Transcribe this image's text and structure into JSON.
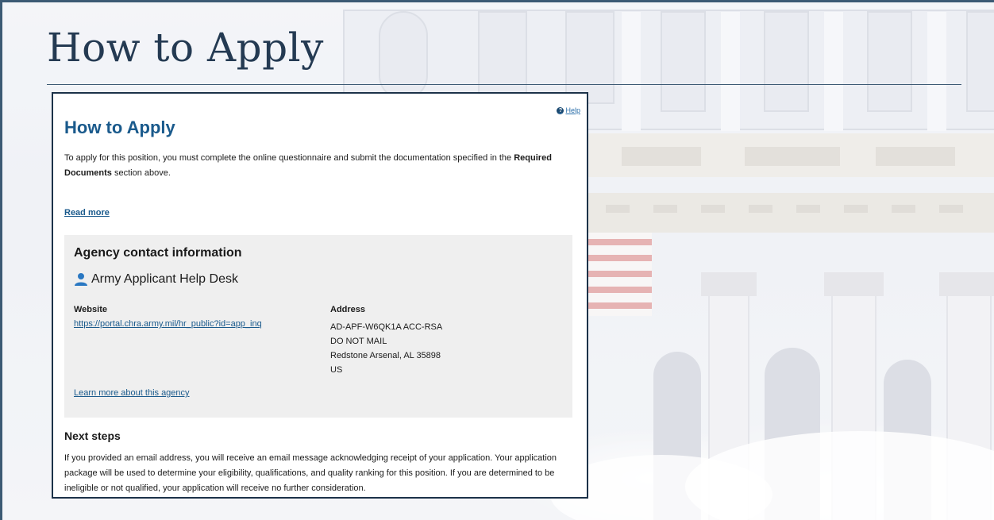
{
  "page": {
    "title": "How to Apply"
  },
  "card": {
    "help_label": "Help",
    "heading": "How to Apply",
    "intro_before": "To apply for this position, you must complete the online questionnaire and submit the documentation specified in the",
    "intro_bold": "Required Documents",
    "intro_after": "section above.",
    "read_more": "Read more"
  },
  "agency": {
    "heading": "Agency contact information",
    "name": "Army Applicant Help Desk",
    "website_label": "Website",
    "website_url": "https://portal.chra.army.mil/hr_public?id=app_inq",
    "address_label": "Address",
    "address_lines": [
      "AD-APF-W6QK1A ACC-RSA",
      "DO NOT MAIL",
      "Redstone Arsenal, AL 35898",
      "US"
    ],
    "learn_more": "Learn more about this agency"
  },
  "next_steps": {
    "heading": "Next steps",
    "body": "If you provided an email address, you will receive an email message acknowledging receipt of your application. Your application package will be used to determine your eligibility, qualifications, and quality ranking for this position. If you are determined to be ineligible or not qualified, your application will receive no further consideration."
  },
  "icons": {
    "help": "question-circle-icon",
    "contact": "person-icon"
  },
  "colors": {
    "title": "#243a52",
    "accent": "#1a5a8c",
    "card_border": "#1c3249",
    "contact_bg": "#efefef"
  }
}
